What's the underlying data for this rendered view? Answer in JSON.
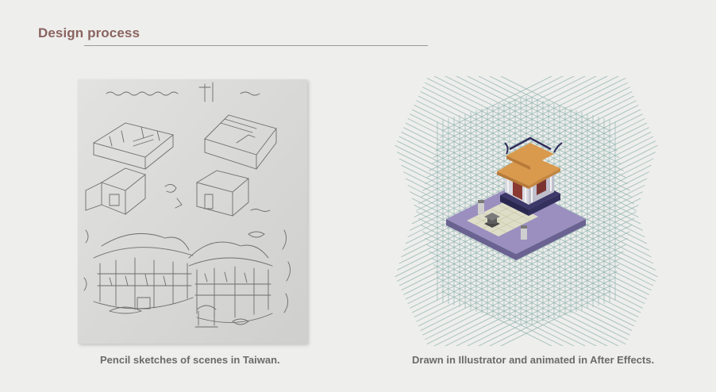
{
  "section": {
    "title": "Design process"
  },
  "figures": [
    {
      "id": "sketch",
      "caption": "Pencil sketches of scenes in Taiwan."
    },
    {
      "id": "illustration",
      "caption": "Drawn in Illustrator and animated in After Effects."
    }
  ],
  "colors": {
    "heading": "#8a6460",
    "caption": "#6b6b6b",
    "grid_line": "#8fb3ad",
    "platform": "#9b8fbf",
    "roof": "#d99a4e"
  }
}
